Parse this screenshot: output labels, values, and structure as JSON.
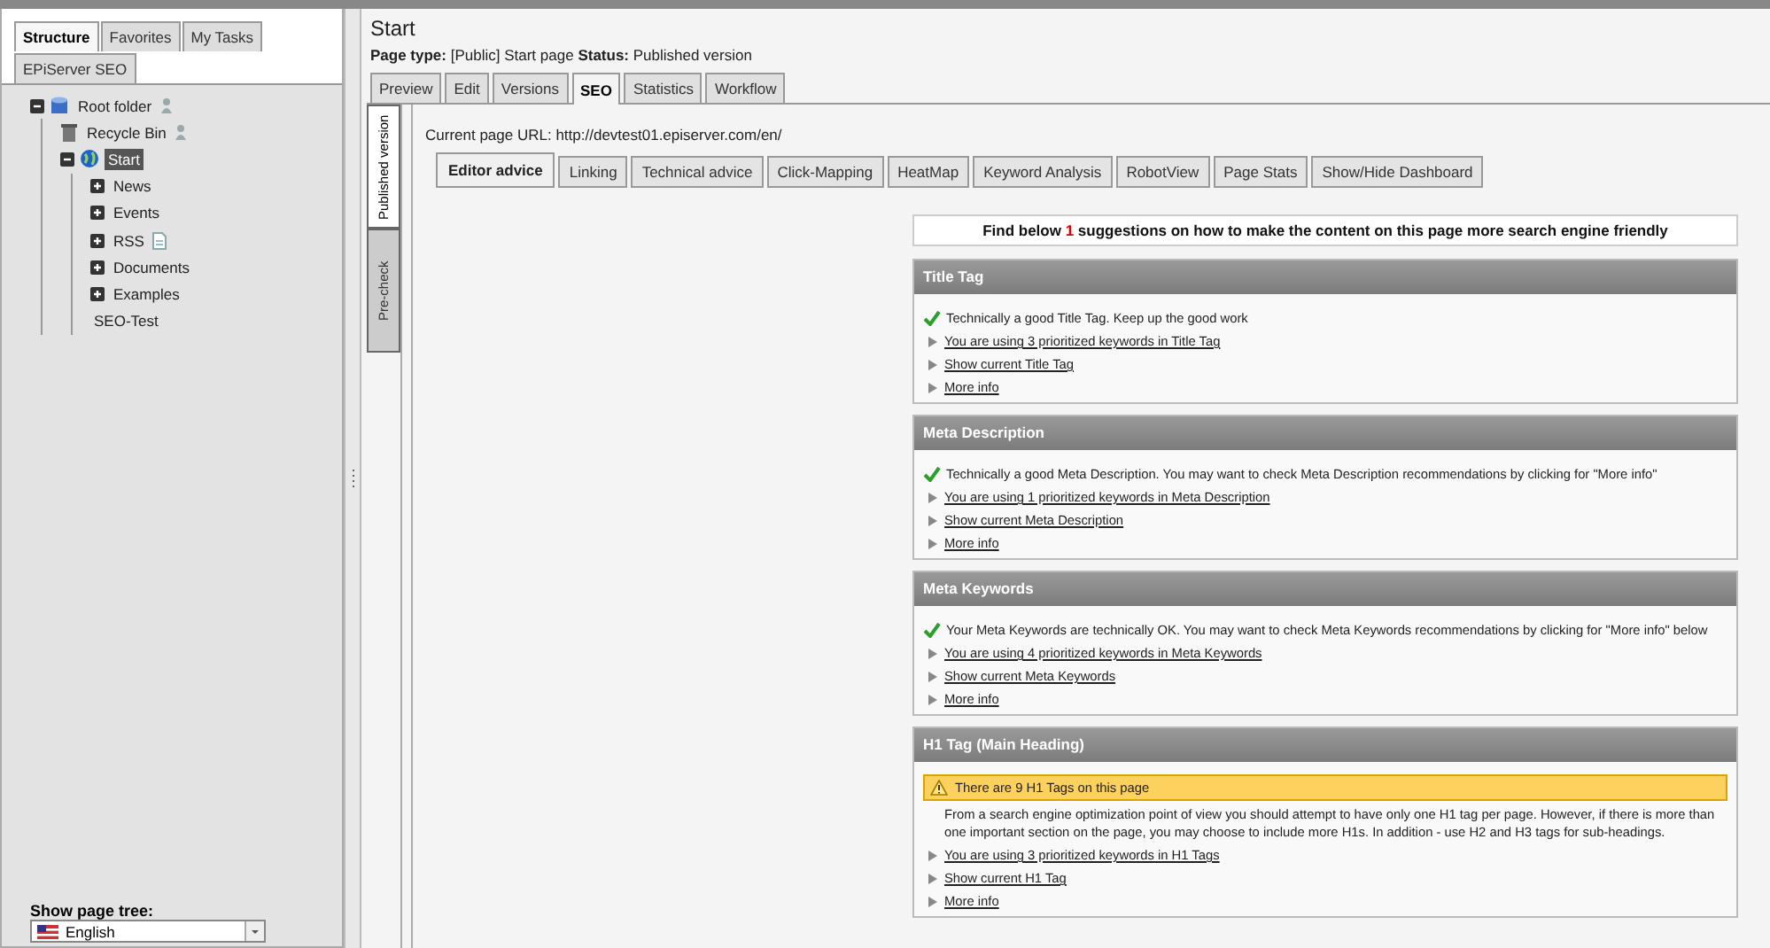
{
  "sidebar": {
    "tabs": [
      {
        "label": "Structure",
        "selected": true
      },
      {
        "label": "Favorites",
        "selected": false
      },
      {
        "label": "My Tasks",
        "selected": false
      },
      {
        "label": "EPiServer SEO",
        "selected": false
      }
    ],
    "tree": [
      {
        "label": "Root folder",
        "kind": "root",
        "expanded": true,
        "selected": false,
        "children": [
          {
            "label": "Recycle Bin",
            "kind": "recycle",
            "selected": false
          },
          {
            "label": "Start",
            "kind": "site",
            "expanded": true,
            "selected": true,
            "children": [
              {
                "label": "News",
                "kind": "page",
                "expanded": false,
                "selected": false
              },
              {
                "label": "Events",
                "kind": "page",
                "expanded": false,
                "selected": false
              },
              {
                "label": "RSS",
                "kind": "feed",
                "expanded": false,
                "selected": false
              },
              {
                "label": "Documents",
                "kind": "page",
                "expanded": false,
                "selected": false
              },
              {
                "label": "Examples",
                "kind": "page",
                "expanded": false,
                "selected": false
              },
              {
                "label": "SEO-Test",
                "kind": "page",
                "selected": false
              }
            ]
          }
        ]
      }
    ],
    "page_tree_label": "Show page tree:",
    "language": "English"
  },
  "page": {
    "title": "Start",
    "info": "**Page type:** [Public] Start page **Status:** Published version",
    "tabs": [
      {
        "label": "Preview",
        "selected": false
      },
      {
        "label": "Edit",
        "selected": false
      },
      {
        "label": "Versions",
        "selected": false
      },
      {
        "label": "SEO",
        "selected": true
      },
      {
        "label": "Statistics",
        "selected": false
      },
      {
        "label": "Workflow",
        "selected": false
      }
    ],
    "side_tabs": [
      {
        "label": "Published version",
        "selected": true
      },
      {
        "label": "Pre-check",
        "selected": false
      }
    ],
    "url_line": "Current page URL: http://devtest01.episerver.com/en/",
    "seo_tabs": [
      {
        "label": "Editor advice",
        "selected": true
      },
      {
        "label": "Linking",
        "selected": false
      },
      {
        "label": "Technical advice",
        "selected": false
      },
      {
        "label": "Click-Mapping",
        "selected": false
      },
      {
        "label": "HeatMap",
        "selected": false
      },
      {
        "label": "Keyword Analysis",
        "selected": false
      },
      {
        "label": "RobotView",
        "selected": false
      },
      {
        "label": "Page Stats",
        "selected": false
      },
      {
        "label": "Show/Hide Dashboard",
        "selected": false
      }
    ],
    "summary": {
      "before": "Find below",
      "count": "1",
      "after": "suggestions on how to make the content on this page more search engine friendly"
    },
    "sections": [
      {
        "title": "Title Tag",
        "kind": "ok",
        "message": "Technically a good Title Tag. Keep up the good work",
        "links": [
          "You are using 3 prioritized keywords in Title Tag",
          "Show current Title Tag",
          "More info"
        ]
      },
      {
        "title": "Meta Description",
        "kind": "ok",
        "message": "Technically a good Meta Description. You may want to check Meta Description recommendations by clicking for \"More info\"",
        "links": [
          "You are using 1 prioritized keywords in Meta Description",
          "Show current Meta Description",
          "More info"
        ]
      },
      {
        "title": "Meta Keywords",
        "kind": "ok",
        "message": "Your Meta Keywords are technically OK. You may want to check Meta Keywords recommendations by clicking for \"More info\" below",
        "links": [
          "You are using 4 prioritized keywords in Meta Keywords",
          "Show current Meta Keywords",
          "More info"
        ]
      },
      {
        "title": "H1 Tag (Main Heading)",
        "kind": "warning",
        "message": "There are 9 H1 Tags on this page",
        "description": "From a search engine optimization point of view you should attempt to have only one H1 tag per page. However, if there is more than one important section on the page, you may choose to include more H1s. In addition - use H2 and H3 tags for sub-headings.",
        "links": [
          "You are using 3 prioritized keywords in H1 Tags",
          "Show current H1 Tag",
          "More info"
        ]
      }
    ]
  }
}
